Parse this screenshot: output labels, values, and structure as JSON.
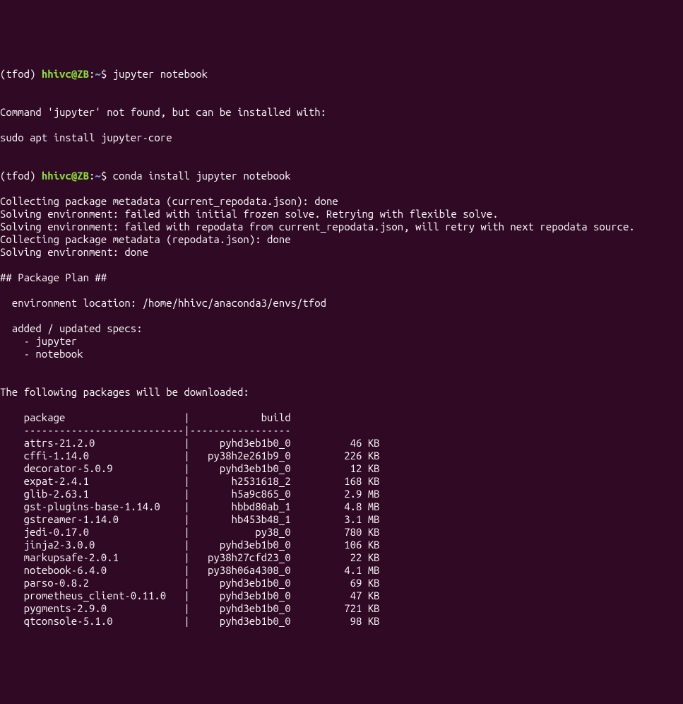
{
  "prompt1": {
    "env": "(tfod) ",
    "userhost": "hhivc@ZB",
    "colon": ":",
    "path": "~",
    "dollar": "$ ",
    "command": "jupyter notebook"
  },
  "output1": [
    "",
    "Command 'jupyter' not found, but can be installed with:",
    "",
    "sudo apt install jupyter-core",
    ""
  ],
  "prompt2": {
    "env": "(tfod) ",
    "userhost": "hhivc@ZB",
    "colon": ":",
    "path": "~",
    "dollar": "$ ",
    "command": "conda install jupyter notebook"
  },
  "output2": [
    "Collecting package metadata (current_repodata.json): done",
    "Solving environment: failed with initial frozen solve. Retrying with flexible solve.",
    "Solving environment: failed with repodata from current_repodata.json, will retry with next repodata source.",
    "Collecting package metadata (repodata.json): done",
    "Solving environment: done",
    "",
    "## Package Plan ##",
    "",
    "  environment location: /home/hhivc/anaconda3/envs/tfod",
    "",
    "  added / updated specs:",
    "    - jupyter",
    "    - notebook",
    "",
    "",
    "The following packages will be downloaded:",
    "",
    "    package                    |            build",
    "    ---------------------------|-----------------",
    "    attrs-21.2.0               |     pyhd3eb1b0_0          46 KB",
    "    cffi-1.14.0                |   py38h2e261b9_0         226 KB",
    "    decorator-5.0.9            |     pyhd3eb1b0_0          12 KB",
    "    expat-2.4.1                |       h2531618_2         168 KB",
    "    glib-2.63.1                |       h5a9c865_0         2.9 MB",
    "    gst-plugins-base-1.14.0    |       hbbd80ab_1         4.8 MB",
    "    gstreamer-1.14.0           |       hb453b48_1         3.1 MB",
    "    jedi-0.17.0                |           py38_0         780 KB",
    "    jinja2-3.0.0               |     pyhd3eb1b0_0         106 KB",
    "    markupsafe-2.0.1           |   py38h27cfd23_0          22 KB",
    "    notebook-6.4.0             |   py38h06a4308_0         4.1 MB",
    "    parso-0.8.2                |     pyhd3eb1b0_0          69 KB",
    "    prometheus_client-0.11.0   |     pyhd3eb1b0_0          47 KB",
    "    pygments-2.9.0             |     pyhd3eb1b0_0         721 KB",
    "    qtconsole-5.1.0            |     pyhd3eb1b0_0          98 KB"
  ]
}
